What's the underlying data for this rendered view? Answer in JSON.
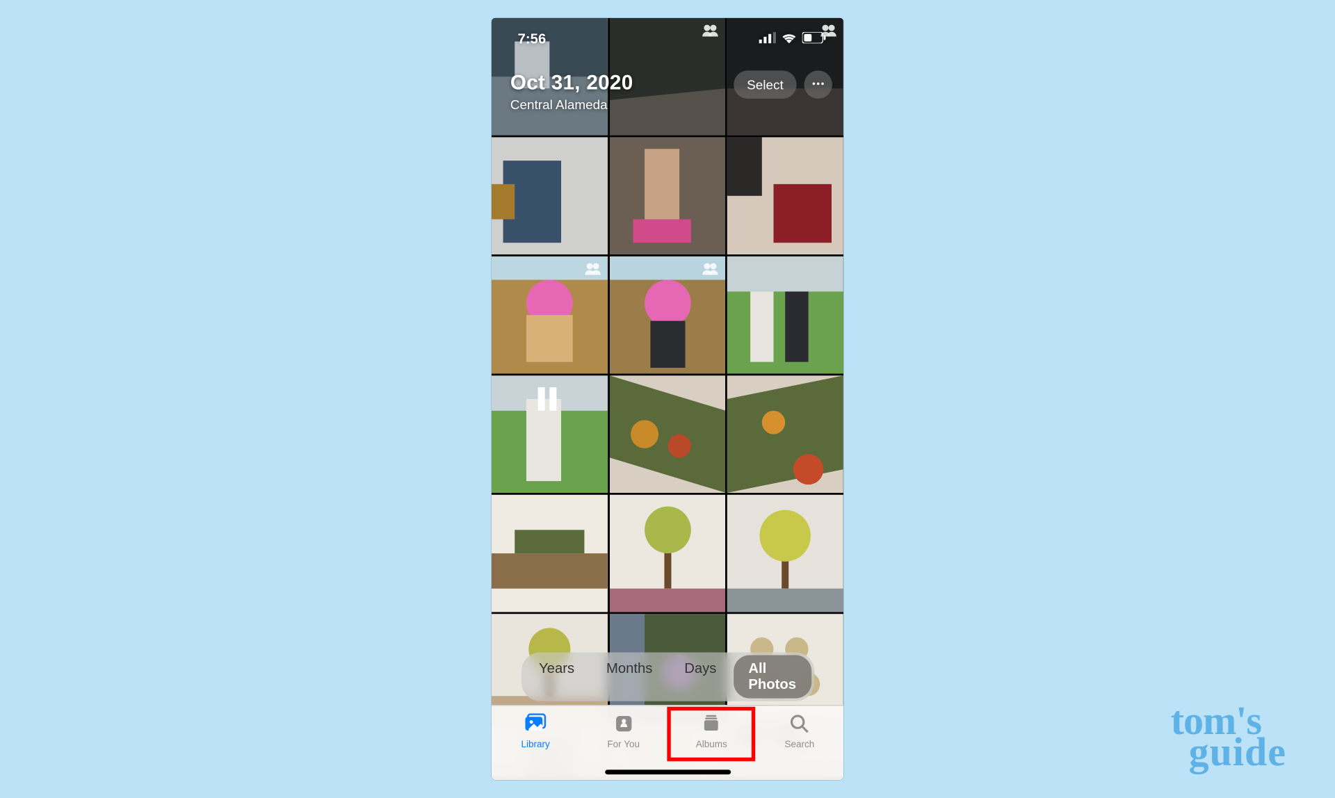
{
  "watermark": {
    "line1": "tom's",
    "line2": "guide"
  },
  "statusbar": {
    "time": "7:56"
  },
  "header": {
    "date": "Oct 31, 2020",
    "location": "Central Alameda"
  },
  "top_controls": {
    "select_label": "Select"
  },
  "segmented": {
    "items": [
      "Years",
      "Months",
      "Days",
      "All Photos"
    ],
    "active_index": 3
  },
  "tabs": {
    "items": [
      {
        "label": "Library",
        "icon": "library-icon",
        "active": true
      },
      {
        "label": "For You",
        "icon": "for-you-icon",
        "active": false
      },
      {
        "label": "Albums",
        "icon": "albums-icon",
        "active": false
      },
      {
        "label": "Search",
        "icon": "search-icon",
        "active": false
      }
    ],
    "highlighted_index": 2
  },
  "grid": {
    "rows": 7,
    "cols": 3,
    "row7_partial_height": 56
  }
}
